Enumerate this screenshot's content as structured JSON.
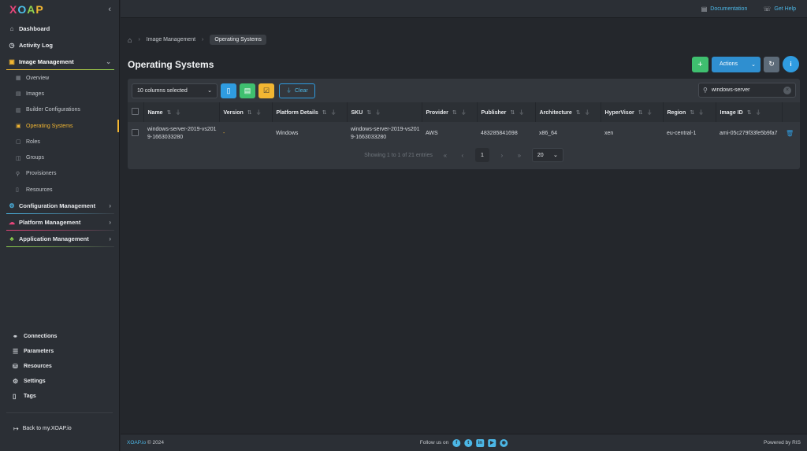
{
  "app": {
    "logo": [
      "X",
      "O",
      "A",
      "P"
    ]
  },
  "topbar": {
    "documentation": "Documentation",
    "help": "Get Help"
  },
  "sidebar": {
    "items": [
      {
        "label": "Dashboard"
      },
      {
        "label": "Activity Log"
      },
      {
        "label": "Image Management"
      },
      {
        "label": "Configuration Management"
      },
      {
        "label": "Platform Management"
      },
      {
        "label": "Application Management"
      }
    ],
    "image_sub": [
      "Overview",
      "Images",
      "Builder Configurations",
      "Operating Systems",
      "Roles",
      "Groups",
      "Provisioners",
      "Resources"
    ],
    "lower": [
      "Connections",
      "Parameters",
      "Resources",
      "Settings",
      "Tags"
    ],
    "back": "Back to my.XOAP.io"
  },
  "breadcrumb": {
    "parent": "Image Management",
    "current": "Operating Systems"
  },
  "page": {
    "title": "Operating Systems",
    "actions_label": "Actions",
    "info": "i"
  },
  "toolbar": {
    "columns_selected": "10 columns selected",
    "clear": "Clear",
    "search_value": "windows-server"
  },
  "table": {
    "headers": [
      "Name",
      "Version",
      "Platform Details",
      "SKU",
      "Provider",
      "Publisher",
      "Architecture",
      "HyperVisor",
      "Region",
      "Image ID"
    ],
    "rows": [
      {
        "name": "windows-server-2019-vs2019-1663033280",
        "version": "-",
        "platform": "Windows",
        "sku": "windows-server-2019-vs2019-1663033280",
        "provider": "AWS",
        "publisher": "483285841698",
        "architecture": "x86_64",
        "hypervisor": "xen",
        "region": "eu-central-1",
        "image_id": "ami-05c279f33fe5b9fa7"
      }
    ]
  },
  "pager": {
    "info": "Showing 1 to 1 of 21 entries",
    "page": "1",
    "size": "20"
  },
  "footer": {
    "brand": "XOAP.io",
    "year": "© 2024",
    "follow": "Follow us on",
    "powered": "Powered by RIS"
  },
  "colors": {
    "accent": "#f2b632",
    "primary": "#2f9ce0",
    "success": "#3fbf6f",
    "bg": "#24272c"
  }
}
